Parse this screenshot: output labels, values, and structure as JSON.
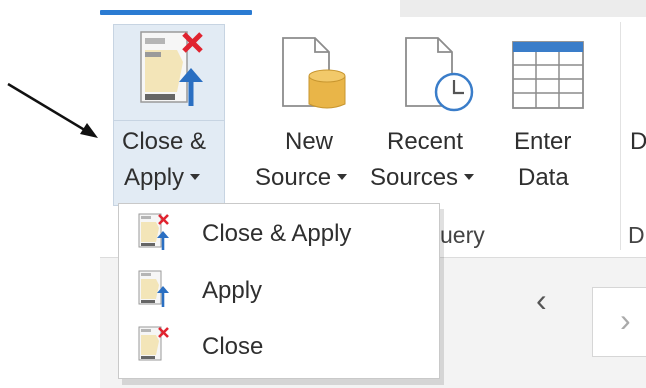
{
  "ribbon": {
    "close_apply": {
      "line1": "Close &",
      "line2": "Apply"
    },
    "new_source": {
      "line1": "New",
      "line2": "Source"
    },
    "recent_sources": {
      "line1": "Recent",
      "line2": "Sources"
    },
    "enter_data": {
      "line1": "Enter",
      "line2": "Data"
    },
    "clipped_label": "D",
    "clipped_group_label": "D",
    "group_label_partial": "uery"
  },
  "menu": {
    "items": [
      {
        "label": "Close & Apply",
        "icon": "close-apply-icon"
      },
      {
        "label": "Apply",
        "icon": "apply-icon"
      },
      {
        "label": "Close",
        "icon": "close-icon"
      }
    ]
  },
  "colors": {
    "accent": "#2b7bd2",
    "close_red": "#e0232f",
    "apply_blue": "#2a6fc2",
    "doc_yellow": "#f3e5b8",
    "db_gold": "#e9b548"
  }
}
